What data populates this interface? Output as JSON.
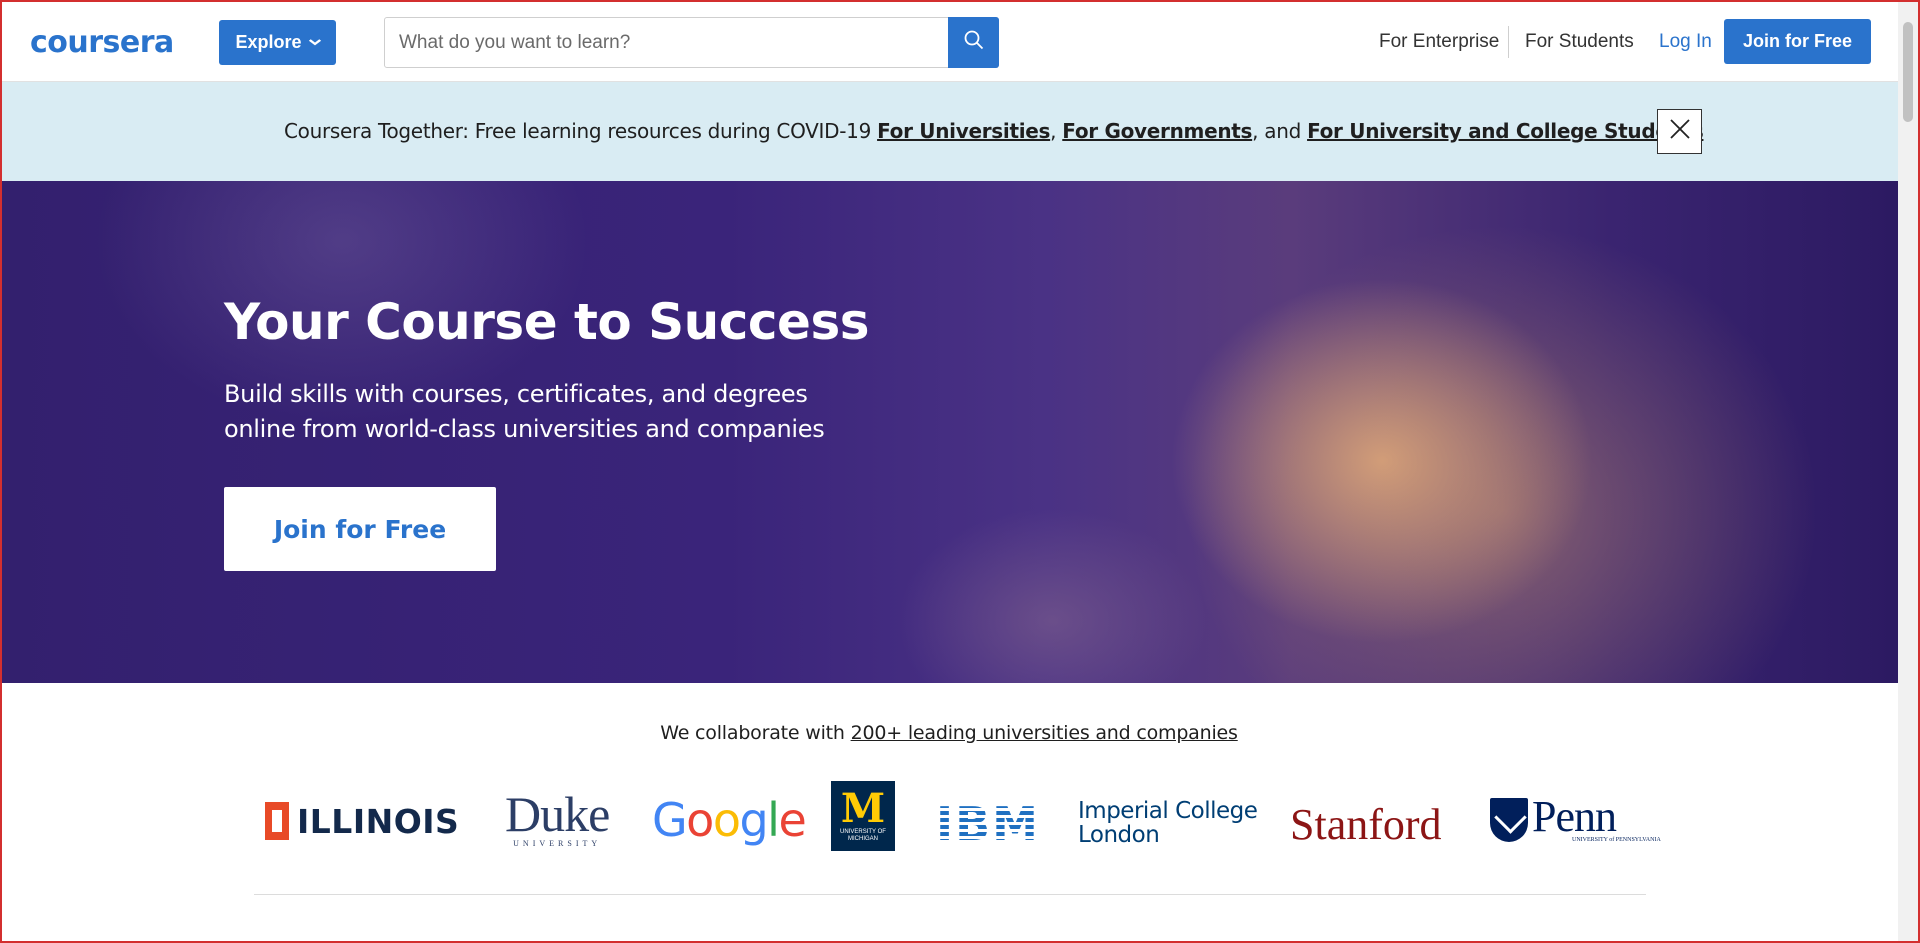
{
  "header": {
    "logo_text": "coursera",
    "explore_label": "Explore",
    "search": {
      "placeholder": "What do you want to learn?"
    },
    "nav": {
      "enterprise": "For Enterprise",
      "students": "For Students",
      "login": "Log In",
      "join": "Join for Free"
    }
  },
  "banner": {
    "text": "Coursera Together: Free learning resources during COVID-19 ",
    "link_universities": "For Universities",
    "sep1": ", ",
    "link_governments": "For Governments",
    "sep2": ", and ",
    "link_students": "For University and College Students"
  },
  "hero": {
    "title": "Your Course to Success",
    "subtitle": "Build skills with courses, certificates, and degrees online from world-class universities and companies",
    "cta": "Join for Free"
  },
  "partners": {
    "intro": "We collaborate with ",
    "link": "200+ leading universities and companies",
    "logos": {
      "illinois": "ILLINOIS",
      "duke": "Duke",
      "duke_sub": "UNIVERSITY",
      "google": "Google",
      "michigan": "M",
      "michigan_sub1": "UNIVERSITY OF",
      "michigan_sub2": "MICHIGAN",
      "ibm": "IBM",
      "imperial_line1": "Imperial College",
      "imperial_line2": "London",
      "stanford": "Stanford",
      "penn": "Penn",
      "penn_sub": "UNIVERSITY of PENNSYLVANIA"
    }
  },
  "colors": {
    "brand": "#2a73cc",
    "banner_bg": "#d9ecf3",
    "hero_bg": "#3a247a"
  },
  "icons": [
    "search-icon",
    "chevron-down-icon",
    "close-icon"
  ]
}
